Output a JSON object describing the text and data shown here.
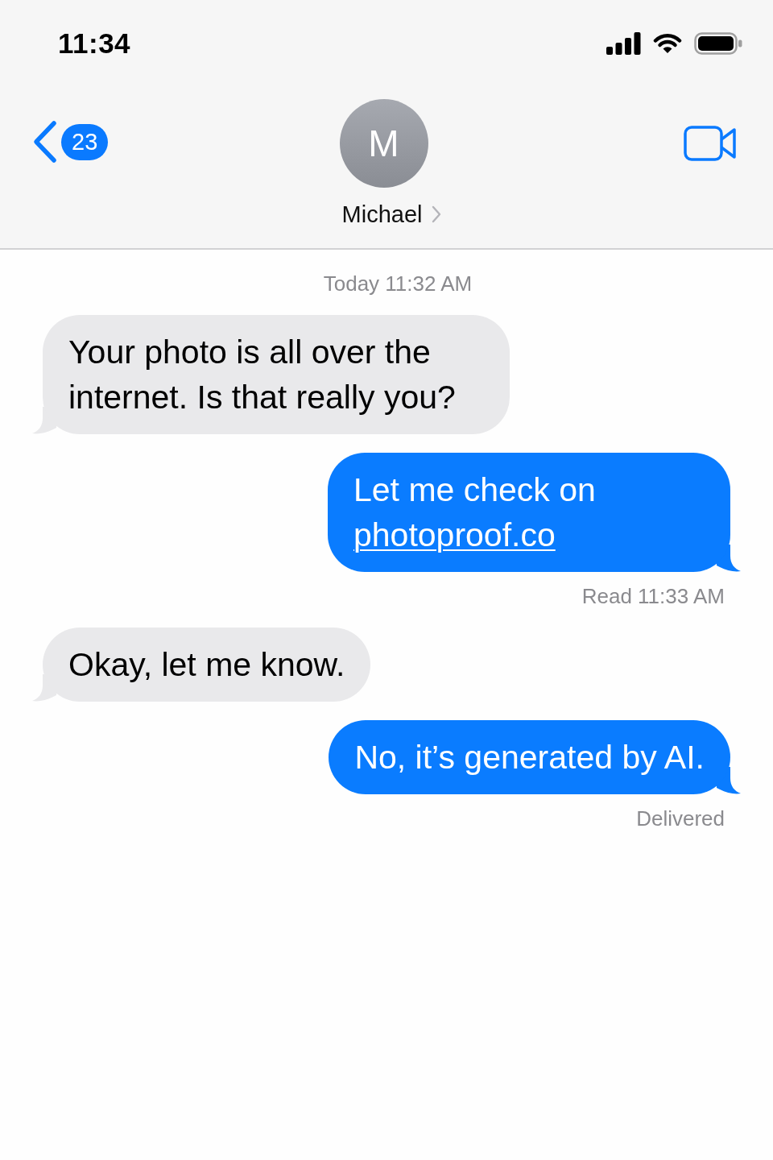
{
  "status_bar": {
    "time": "11:34"
  },
  "nav": {
    "unread_count": "23",
    "contact_initial": "M",
    "contact_name": "Michael"
  },
  "timestamp": "Today 11:32 AM",
  "messages": [
    {
      "kind": "received",
      "text": "Your photo is all over the internet. Is that really you?"
    },
    {
      "kind": "sent",
      "text": "Let me check on",
      "link": "photoproof.co",
      "receipt": "Read 11:33 AM"
    },
    {
      "kind": "received",
      "text": "Okay, let me know."
    },
    {
      "kind": "sent",
      "text": "No, it’s generated by AI.",
      "receipt": "Delivered"
    }
  ]
}
